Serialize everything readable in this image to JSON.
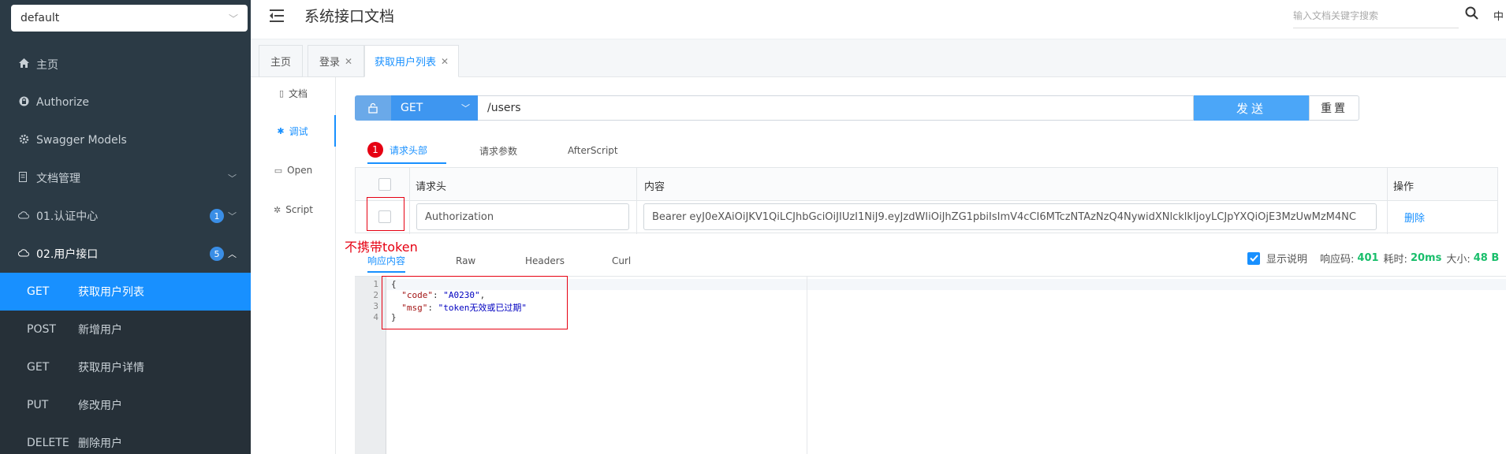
{
  "sidebar": {
    "group_select": "default",
    "nav": [
      {
        "label": "主页",
        "icon": "home-icon"
      },
      {
        "label": "Authorize",
        "icon": "lock-icon"
      },
      {
        "label": "Swagger Models",
        "icon": "gear-icon"
      },
      {
        "label": "文档管理",
        "icon": "document-icon"
      },
      {
        "label": "01.认证中心",
        "icon": "cloud-icon",
        "badge": "1"
      },
      {
        "label": "02.用户接口",
        "icon": "cloud-icon",
        "badge": "5"
      }
    ],
    "apis": [
      {
        "method": "GET",
        "label": "获取用户列表",
        "active": true
      },
      {
        "method": "POST",
        "label": "新增用户"
      },
      {
        "method": "GET",
        "label": "获取用户详情"
      },
      {
        "method": "PUT",
        "label": "修改用户"
      },
      {
        "method": "DELETE",
        "label": "删除用户"
      }
    ]
  },
  "header": {
    "title": "系统接口文档",
    "search_placeholder": "输入文档关键字搜索",
    "lang": "中"
  },
  "tabs": [
    {
      "label": "主页"
    },
    {
      "label": "登录",
      "closable": true
    },
    {
      "label": "获取用户列表",
      "closable": true,
      "active": true
    }
  ],
  "submenu": [
    {
      "label": "文档"
    },
    {
      "label": "调试",
      "active": true
    },
    {
      "label": "Open"
    },
    {
      "label": "Script"
    }
  ],
  "request": {
    "method": "GET",
    "url": "/users",
    "send_label": "发送",
    "reset_label": "重置"
  },
  "param_tabs": {
    "badge": "1",
    "headers": "请求头部",
    "params": "请求参数",
    "after": "AfterScript"
  },
  "header_table": {
    "col_name": "请求头",
    "col_value": "内容",
    "col_action": "操作",
    "row_name": "Authorization",
    "row_value": "Bearer eyJ0eXAiOiJKV1QiLCJhbGciOiJIUzI1NiJ9.eyJzdWIiOiJhZG1pbiIsImV4cCI6MTczNTAzNzQ4NywidXNlcklkIjoyLCJpYXQiOjE3MzUwMzM4NC",
    "delete_label": "删除"
  },
  "annotation": "不携带token",
  "response_tabs": {
    "content": "响应内容",
    "raw": "Raw",
    "headers": "Headers",
    "curl": "Curl"
  },
  "response_meta": {
    "show_desc": "显示说明",
    "code_label": "响应码:",
    "code": "401",
    "time_label": "耗时:",
    "time": "20ms",
    "size_label": "大小:",
    "size": "48 B"
  },
  "response_body": {
    "line_numbers": [
      "1",
      "2",
      "3",
      "4"
    ],
    "open": "{",
    "code_key": "\"code\"",
    "code_val": "\"A0230\"",
    "msg_key": "\"msg\"",
    "msg_val": "\"token无效或已过期\"",
    "close": "}"
  }
}
